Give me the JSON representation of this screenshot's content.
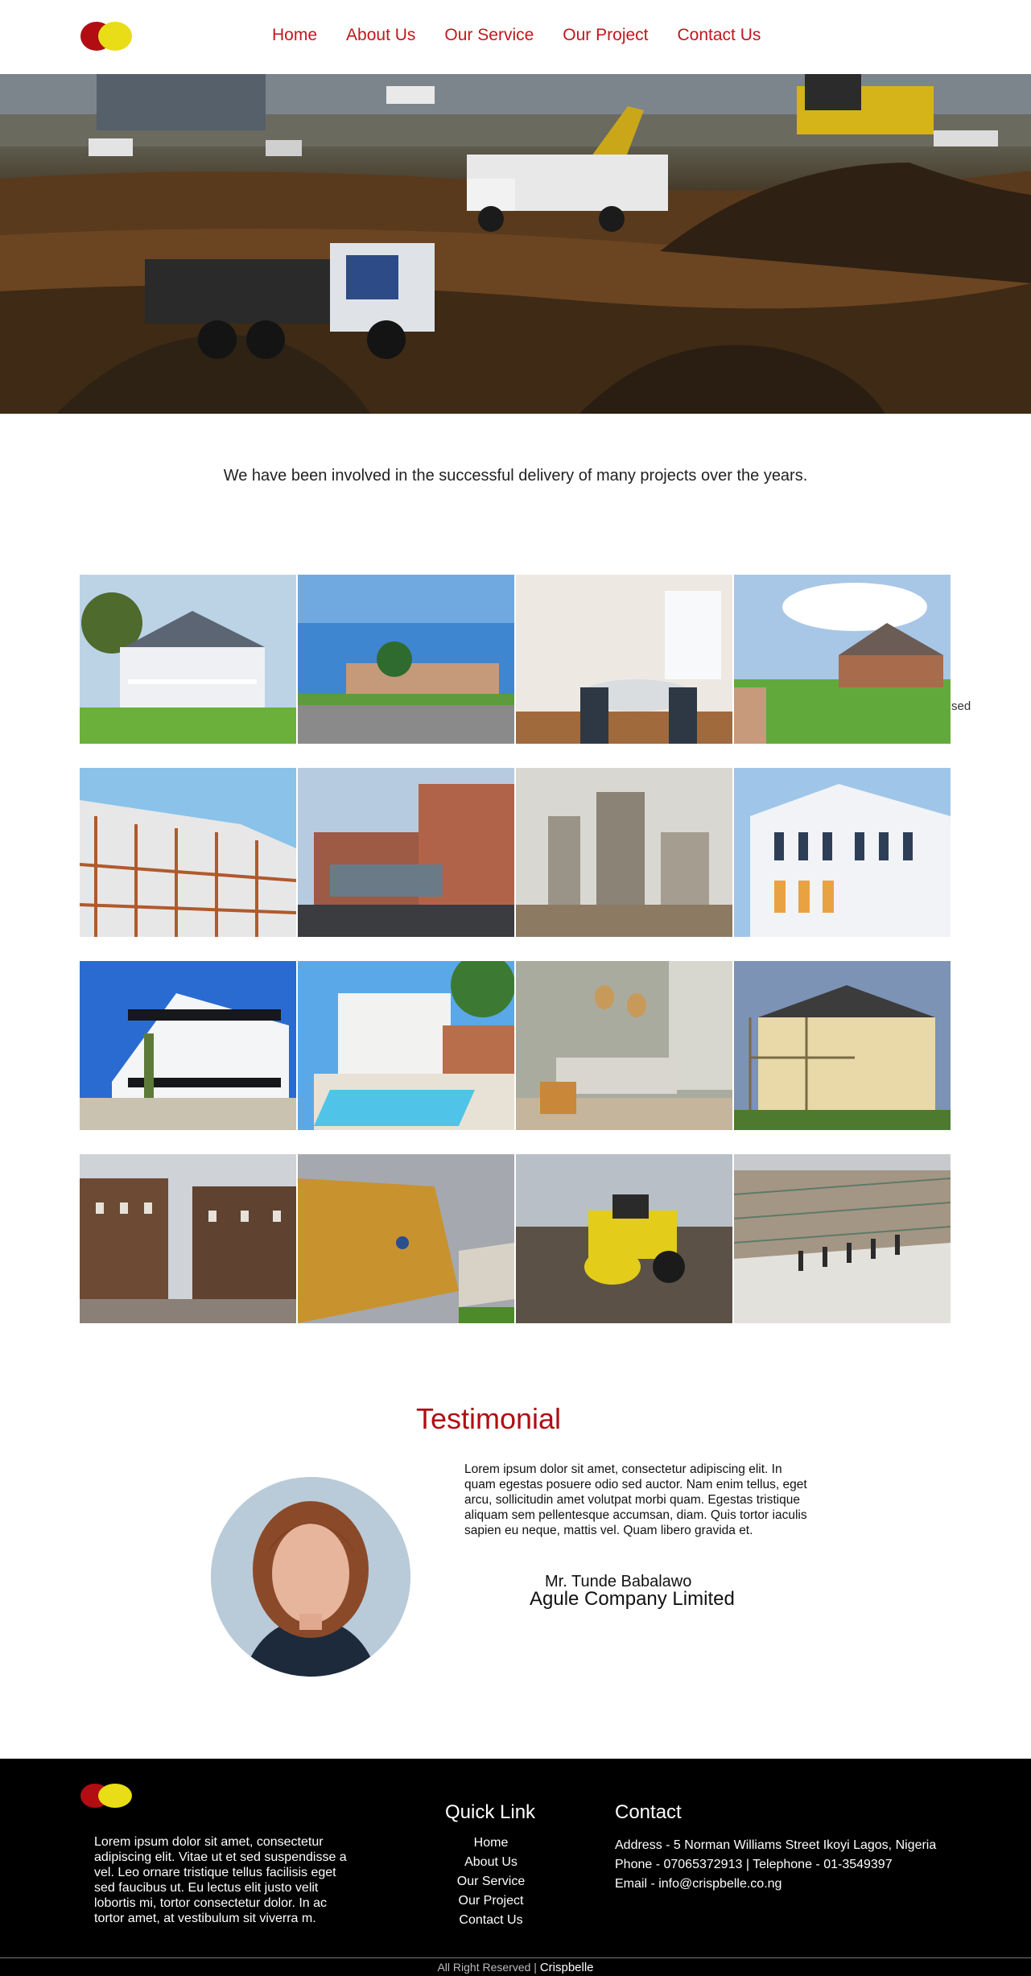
{
  "nav": {
    "items": [
      {
        "label": "Home"
      },
      {
        "label": "About Us"
      },
      {
        "label": "Our Service"
      },
      {
        "label": "Our Project"
      },
      {
        "label": "Contact Us"
      }
    ]
  },
  "intro": {
    "text": "We have been involved in the successful delivery of many projects over the years."
  },
  "gallery": {
    "stray_text": "sed",
    "images": [
      "white-victorian-house-photo",
      "suburban-street-houses-photo",
      "modern-dining-room-photo",
      "brick-house-lawn-photo",
      "apartment-frame-construction-photo",
      "brick-hospital-building-photo",
      "cement-plant-photo",
      "white-corner-building-photo",
      "white-modern-villa-photo",
      "pool-house-photo",
      "living-room-interior-photo",
      "house-scaffolding-photo",
      "brick-apartment-block-photo",
      "roofers-on-roof-photo",
      "road-roller-photo",
      "workers-on-site-photo"
    ]
  },
  "testimonial": {
    "title": "Testimonial",
    "text": "Lorem ipsum dolor sit amet, consectetur adipiscing elit. In quam egestas posuere odio sed auctor. Nam enim tellus, eget arcu, sollicitudin amet volutpat morbi quam. Egestas tristique aliquam sem pellentesque accumsan, diam. Quis tortor iaculis sapien eu neque, mattis vel. Quam libero gravida et.",
    "name": "Mr. Tunde Babalawo",
    "company": "Agule Company Limited"
  },
  "footer": {
    "about": "Lorem ipsum dolor sit amet, consectetur adipiscing elit. Vitae ut et sed suspendisse a vel. Leo ornare tristique tellus facilisis eget sed faucibus ut. Eu lectus elit justo velit lobortis mi, tortor consectetur dolor. In ac tortor amet, at vestibulum sit viverra m.",
    "quick_title": "Quick Link",
    "quick_links": [
      {
        "label": "Home"
      },
      {
        "label": "About Us"
      },
      {
        "label": "Our Service"
      },
      {
        "label": "Our Project"
      },
      {
        "label": "Contact Us"
      }
    ],
    "contact_title": "Contact",
    "address": "Address - 5 Norman Williams Street Ikoyi Lagos, Nigeria",
    "phone": "Phone - 07065372913 | Telephone - 01-3549397",
    "email": "Email - info@crispbelle.co.ng",
    "copyright": "All Right Reserved |",
    "brand": "Crispbelle"
  },
  "colors": {
    "brand_red": "#b10d13",
    "brand_yellow": "#e8dd16",
    "nav_link": "#c3161c"
  }
}
